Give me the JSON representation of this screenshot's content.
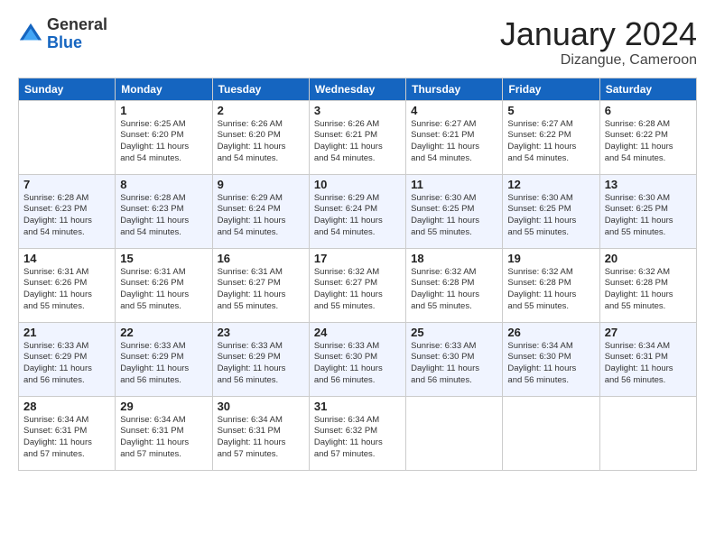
{
  "header": {
    "logo_general": "General",
    "logo_blue": "Blue",
    "month_title": "January 2024",
    "subtitle": "Dizangue, Cameroon"
  },
  "days_of_week": [
    "Sunday",
    "Monday",
    "Tuesday",
    "Wednesday",
    "Thursday",
    "Friday",
    "Saturday"
  ],
  "weeks": [
    {
      "days": [
        {
          "num": "",
          "info": ""
        },
        {
          "num": "1",
          "info": "Sunrise: 6:25 AM\nSunset: 6:20 PM\nDaylight: 11 hours\nand 54 minutes."
        },
        {
          "num": "2",
          "info": "Sunrise: 6:26 AM\nSunset: 6:20 PM\nDaylight: 11 hours\nand 54 minutes."
        },
        {
          "num": "3",
          "info": "Sunrise: 6:26 AM\nSunset: 6:21 PM\nDaylight: 11 hours\nand 54 minutes."
        },
        {
          "num": "4",
          "info": "Sunrise: 6:27 AM\nSunset: 6:21 PM\nDaylight: 11 hours\nand 54 minutes."
        },
        {
          "num": "5",
          "info": "Sunrise: 6:27 AM\nSunset: 6:22 PM\nDaylight: 11 hours\nand 54 minutes."
        },
        {
          "num": "6",
          "info": "Sunrise: 6:28 AM\nSunset: 6:22 PM\nDaylight: 11 hours\nand 54 minutes."
        }
      ]
    },
    {
      "days": [
        {
          "num": "7",
          "info": "Sunrise: 6:28 AM\nSunset: 6:23 PM\nDaylight: 11 hours\nand 54 minutes."
        },
        {
          "num": "8",
          "info": "Sunrise: 6:28 AM\nSunset: 6:23 PM\nDaylight: 11 hours\nand 54 minutes."
        },
        {
          "num": "9",
          "info": "Sunrise: 6:29 AM\nSunset: 6:24 PM\nDaylight: 11 hours\nand 54 minutes."
        },
        {
          "num": "10",
          "info": "Sunrise: 6:29 AM\nSunset: 6:24 PM\nDaylight: 11 hours\nand 54 minutes."
        },
        {
          "num": "11",
          "info": "Sunrise: 6:30 AM\nSunset: 6:25 PM\nDaylight: 11 hours\nand 55 minutes."
        },
        {
          "num": "12",
          "info": "Sunrise: 6:30 AM\nSunset: 6:25 PM\nDaylight: 11 hours\nand 55 minutes."
        },
        {
          "num": "13",
          "info": "Sunrise: 6:30 AM\nSunset: 6:25 PM\nDaylight: 11 hours\nand 55 minutes."
        }
      ]
    },
    {
      "days": [
        {
          "num": "14",
          "info": "Sunrise: 6:31 AM\nSunset: 6:26 PM\nDaylight: 11 hours\nand 55 minutes."
        },
        {
          "num": "15",
          "info": "Sunrise: 6:31 AM\nSunset: 6:26 PM\nDaylight: 11 hours\nand 55 minutes."
        },
        {
          "num": "16",
          "info": "Sunrise: 6:31 AM\nSunset: 6:27 PM\nDaylight: 11 hours\nand 55 minutes."
        },
        {
          "num": "17",
          "info": "Sunrise: 6:32 AM\nSunset: 6:27 PM\nDaylight: 11 hours\nand 55 minutes."
        },
        {
          "num": "18",
          "info": "Sunrise: 6:32 AM\nSunset: 6:28 PM\nDaylight: 11 hours\nand 55 minutes."
        },
        {
          "num": "19",
          "info": "Sunrise: 6:32 AM\nSunset: 6:28 PM\nDaylight: 11 hours\nand 55 minutes."
        },
        {
          "num": "20",
          "info": "Sunrise: 6:32 AM\nSunset: 6:28 PM\nDaylight: 11 hours\nand 55 minutes."
        }
      ]
    },
    {
      "days": [
        {
          "num": "21",
          "info": "Sunrise: 6:33 AM\nSunset: 6:29 PM\nDaylight: 11 hours\nand 56 minutes."
        },
        {
          "num": "22",
          "info": "Sunrise: 6:33 AM\nSunset: 6:29 PM\nDaylight: 11 hours\nand 56 minutes."
        },
        {
          "num": "23",
          "info": "Sunrise: 6:33 AM\nSunset: 6:29 PM\nDaylight: 11 hours\nand 56 minutes."
        },
        {
          "num": "24",
          "info": "Sunrise: 6:33 AM\nSunset: 6:30 PM\nDaylight: 11 hours\nand 56 minutes."
        },
        {
          "num": "25",
          "info": "Sunrise: 6:33 AM\nSunset: 6:30 PM\nDaylight: 11 hours\nand 56 minutes."
        },
        {
          "num": "26",
          "info": "Sunrise: 6:34 AM\nSunset: 6:30 PM\nDaylight: 11 hours\nand 56 minutes."
        },
        {
          "num": "27",
          "info": "Sunrise: 6:34 AM\nSunset: 6:31 PM\nDaylight: 11 hours\nand 56 minutes."
        }
      ]
    },
    {
      "days": [
        {
          "num": "28",
          "info": "Sunrise: 6:34 AM\nSunset: 6:31 PM\nDaylight: 11 hours\nand 57 minutes."
        },
        {
          "num": "29",
          "info": "Sunrise: 6:34 AM\nSunset: 6:31 PM\nDaylight: 11 hours\nand 57 minutes."
        },
        {
          "num": "30",
          "info": "Sunrise: 6:34 AM\nSunset: 6:31 PM\nDaylight: 11 hours\nand 57 minutes."
        },
        {
          "num": "31",
          "info": "Sunrise: 6:34 AM\nSunset: 6:32 PM\nDaylight: 11 hours\nand 57 minutes."
        },
        {
          "num": "",
          "info": ""
        },
        {
          "num": "",
          "info": ""
        },
        {
          "num": "",
          "info": ""
        }
      ]
    }
  ]
}
